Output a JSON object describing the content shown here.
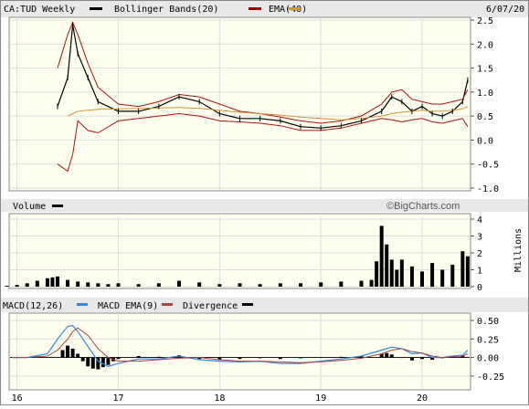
{
  "header": {
    "symbol_label": "CA:TUD Weekly",
    "date_label": "6/07/20",
    "legend": [
      {
        "label": "Bollinger Bands(20)",
        "color": "#000000"
      },
      {
        "label": "EMA(40)",
        "color": "#990000"
      },
      {
        "label": "",
        "color": "#cc9933"
      }
    ]
  },
  "volume_panel": {
    "label": "Volume",
    "watermark": "©BigCharts.com",
    "unit_label": "Millions"
  },
  "macd_panel": {
    "legend": [
      {
        "label": "MACD(12,26)",
        "color": "#3388dd"
      },
      {
        "label": "MACD EMA(9)",
        "color": "#aa4444"
      },
      {
        "label": "Divergence",
        "color": "#000000"
      }
    ]
  },
  "colors": {
    "plot_bg": "#fffff0",
    "price": "#000000",
    "bollinger": "#aa1111",
    "ema": "#cc9933",
    "macd": "#3388dd",
    "macd_signal": "#aa4444",
    "volume": "#000000"
  },
  "chart_data": [
    {
      "type": "line",
      "panel": "price",
      "y_ticks": [
        "2.5",
        "2.0",
        "1.5",
        "1.0",
        "0.5",
        "0.0",
        "-0.5",
        "-1.0"
      ],
      "ylim": [
        -1.0,
        2.5
      ],
      "x_ticks": [
        "16",
        "17",
        "18",
        "19",
        "20"
      ],
      "x": [
        16.4,
        16.5,
        16.55,
        16.6,
        16.7,
        16.8,
        17.0,
        17.2,
        17.4,
        17.6,
        17.8,
        18.0,
        18.2,
        18.4,
        18.6,
        18.8,
        19.0,
        19.2,
        19.4,
        19.6,
        19.7,
        19.8,
        19.9,
        20.0,
        20.1,
        20.2,
        20.3,
        20.4,
        20.45
      ],
      "series": [
        {
          "values": [
            0.7,
            1.3,
            2.4,
            1.8,
            1.3,
            0.8,
            0.6,
            0.6,
            0.7,
            0.9,
            0.8,
            0.55,
            0.45,
            0.45,
            0.4,
            0.28,
            0.25,
            0.3,
            0.4,
            0.6,
            0.9,
            0.8,
            0.6,
            0.7,
            0.55,
            0.5,
            0.6,
            0.8,
            1.25
          ]
        },
        {
          "values": [
            -0.5,
            -0.65,
            -0.3,
            0.4,
            0.2,
            0.15,
            0.4,
            0.45,
            0.5,
            0.55,
            0.5,
            0.4,
            0.38,
            0.35,
            0.3,
            0.2,
            0.2,
            0.25,
            0.35,
            0.45,
            0.42,
            0.38,
            0.42,
            0.45,
            0.38,
            0.35,
            0.4,
            0.45,
            0.28
          ]
        },
        {
          "values": [
            1.5,
            2.2,
            2.45,
            2.2,
            1.6,
            1.1,
            0.75,
            0.7,
            0.8,
            0.95,
            0.9,
            0.75,
            0.6,
            0.55,
            0.48,
            0.4,
            0.35,
            0.4,
            0.5,
            0.75,
            1.0,
            1.05,
            0.85,
            0.8,
            0.75,
            0.75,
            0.8,
            0.85,
            1.05
          ]
        },
        {
          "values": [
            null,
            0.5,
            0.55,
            0.6,
            0.62,
            0.64,
            0.65,
            0.66,
            0.67,
            0.68,
            0.66,
            0.62,
            0.58,
            0.55,
            0.52,
            0.48,
            0.45,
            0.42,
            0.45,
            0.5,
            0.55,
            0.58,
            0.6,
            0.62,
            0.6,
            0.6,
            0.62,
            0.65,
            0.7
          ]
        }
      ]
    },
    {
      "type": "bar",
      "panel": "volume",
      "y_ticks": [
        "4",
        "3",
        "2",
        "1",
        "0"
      ],
      "ylim": [
        0,
        4
      ],
      "x": [
        15.9,
        16.0,
        16.1,
        16.2,
        16.3,
        16.35,
        16.4,
        16.5,
        16.6,
        16.7,
        16.8,
        16.9,
        17.0,
        17.2,
        17.4,
        17.6,
        17.8,
        18.0,
        18.2,
        18.4,
        18.6,
        18.8,
        19.0,
        19.2,
        19.4,
        19.5,
        19.55,
        19.6,
        19.65,
        19.7,
        19.75,
        19.8,
        19.9,
        20.0,
        20.1,
        20.2,
        20.3,
        20.4,
        20.45
      ],
      "values": [
        0.05,
        0.1,
        0.2,
        0.35,
        0.5,
        0.55,
        0.6,
        0.4,
        0.3,
        0.25,
        0.2,
        0.15,
        0.2,
        0.15,
        0.2,
        0.35,
        0.25,
        0.15,
        0.2,
        0.15,
        0.2,
        0.2,
        0.25,
        0.3,
        0.35,
        0.4,
        1.5,
        3.6,
        2.5,
        1.6,
        1.0,
        1.6,
        1.2,
        0.9,
        1.4,
        1.0,
        1.3,
        2.1,
        1.8
      ]
    },
    {
      "type": "line",
      "panel": "macd",
      "y_ticks": [
        "0.50",
        "0.25",
        "0.00",
        "-0.25"
      ],
      "ylim": [
        -0.4,
        0.55
      ],
      "x": [
        15.95,
        16.1,
        16.3,
        16.4,
        16.5,
        16.55,
        16.6,
        16.7,
        16.8,
        16.9,
        17.0,
        17.2,
        17.4,
        17.6,
        17.8,
        18.0,
        18.2,
        18.4,
        18.6,
        18.8,
        19.0,
        19.2,
        19.4,
        19.6,
        19.7,
        19.8,
        19.9,
        20.0,
        20.1,
        20.2,
        20.3,
        20.4,
        20.45
      ],
      "series": [
        {
          "values": [
            0.0,
            0.0,
            0.05,
            0.25,
            0.42,
            0.43,
            0.35,
            0.15,
            -0.05,
            -0.12,
            -0.08,
            -0.02,
            -0.02,
            0.02,
            -0.03,
            -0.05,
            -0.06,
            -0.05,
            -0.08,
            -0.08,
            -0.05,
            -0.02,
            0.02,
            0.1,
            0.14,
            0.12,
            0.05,
            0.06,
            0.0,
            0.0,
            0.02,
            0.03,
            0.1
          ]
        },
        {
          "values": [
            0.0,
            0.0,
            0.02,
            0.1,
            0.25,
            0.35,
            0.4,
            0.3,
            0.12,
            0.0,
            -0.05,
            -0.05,
            -0.03,
            -0.01,
            0.0,
            -0.03,
            -0.05,
            -0.05,
            -0.06,
            -0.07,
            -0.06,
            -0.04,
            -0.01,
            0.05,
            0.1,
            0.12,
            0.08,
            0.06,
            0.02,
            0.0,
            0.01,
            0.02,
            0.05
          ]
        }
      ],
      "divergence": {
        "x": [
          16.45,
          16.5,
          16.55,
          16.6,
          16.65,
          16.7,
          16.75,
          16.8,
          16.85,
          16.9,
          16.95,
          17.0,
          17.2,
          17.4,
          17.6,
          17.8,
          18.0,
          18.2,
          18.4,
          18.6,
          18.8,
          19.0,
          19.2,
          19.4,
          19.6,
          19.65,
          19.7,
          19.8,
          19.9,
          20.0,
          20.1,
          20.2,
          20.3,
          20.4
        ],
        "values": [
          0.1,
          0.16,
          0.12,
          0.05,
          -0.05,
          -0.12,
          -0.15,
          -0.16,
          -0.13,
          -0.1,
          -0.05,
          -0.02,
          0.02,
          0.01,
          0.03,
          -0.02,
          -0.03,
          -0.02,
          -0.01,
          -0.02,
          -0.01,
          0.0,
          0.01,
          0.02,
          0.05,
          0.06,
          0.04,
          0.0,
          -0.04,
          -0.02,
          -0.03,
          -0.01,
          0.01,
          0.03
        ]
      }
    }
  ]
}
